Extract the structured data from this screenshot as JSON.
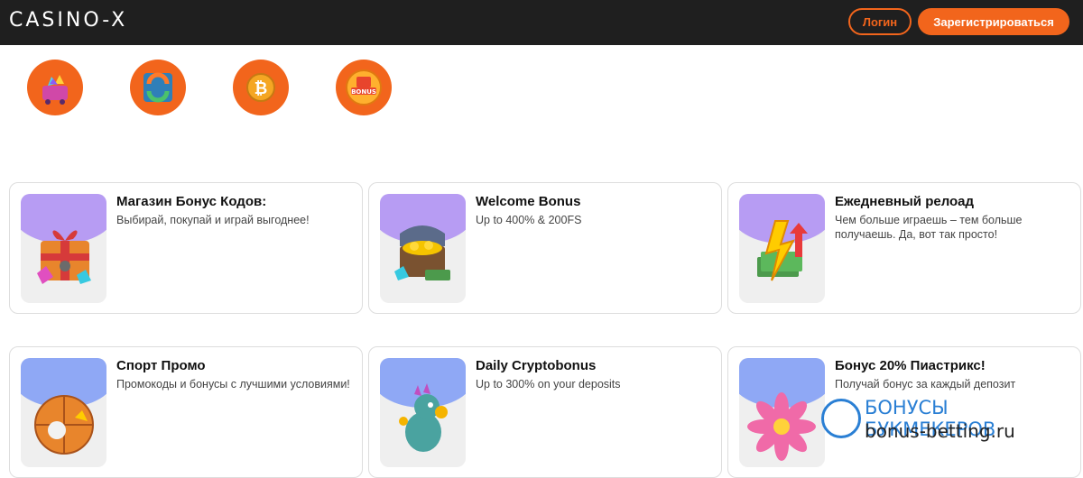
{
  "header": {
    "logo": "CASINO-X",
    "login_label": "Логин",
    "register_label": "Зарегистрироваться"
  },
  "categories": [
    {
      "icon": "gem-cart-icon"
    },
    {
      "icon": "exchange-icon"
    },
    {
      "icon": "bitcoin-coins-icon"
    },
    {
      "icon": "bonus-gift-icon"
    }
  ],
  "cards": [
    {
      "title": "Магазин Бонус Кодов:",
      "desc": "Выбирай, покупай и играй выгоднее!",
      "icon": "gift-box-gems-icon",
      "accent": "#b79cf3"
    },
    {
      "title": "Welcome Bonus",
      "desc": "Up to 400% & 200FS",
      "icon": "treasure-chest-icon",
      "accent": "#b79cf3"
    },
    {
      "title": "Ежедневный релоад",
      "desc": "Чем больше играешь – тем больше получаешь. Да, вот так просто!",
      "icon": "cash-lightning-icon",
      "accent": "#b79cf3"
    },
    {
      "title": "Спорт Промо",
      "desc": "Промокоды и бонусы с лучшими условиями!",
      "icon": "sport-balls-icon",
      "accent": "#8fa8f5"
    },
    {
      "title": "Daily Cryptobonus",
      "desc": "Up to 300% on your deposits",
      "icon": "crypto-dragon-icon",
      "accent": "#8fa8f5"
    },
    {
      "title": "Бонус 20% Пиастрикс!",
      "desc": "Получай бонус за каждый депозит",
      "icon": "flower-icon",
      "accent": "#8fa8f5"
    }
  ],
  "watermark": {
    "line1": "БОНУСЫ БУКМЕКЕРОВ",
    "line2": "bonus-betting.ru"
  },
  "colors": {
    "brand": "#f2651c",
    "header_bg": "#1f1f1f"
  }
}
